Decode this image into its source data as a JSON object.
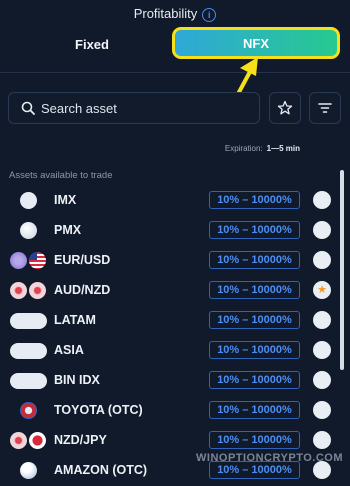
{
  "header": {
    "title": "Profitability",
    "info_icon": "info-icon",
    "tabs": [
      {
        "label": "Fixed",
        "selected": false
      },
      {
        "label": "NFX",
        "selected": true
      }
    ],
    "highlight_color": "#f7e019",
    "nfx_gradient": [
      "#2fa8d9",
      "#27c98f"
    ]
  },
  "search": {
    "placeholder": "Search asset",
    "icon": "search-icon"
  },
  "toolbar": {
    "favorites_icon": "star-icon",
    "filter_icon": "filter-icon"
  },
  "expiration": {
    "label": "Expiration:",
    "value": "1—5 min"
  },
  "section_label": "Assets available to trade",
  "assets": [
    {
      "name": "IMX",
      "payout": "10% – 10000%",
      "favorite": false
    },
    {
      "name": "PMX",
      "payout": "10% – 10000%",
      "favorite": false
    },
    {
      "name": "EUR/USD",
      "payout": "10% – 10000%",
      "favorite": false
    },
    {
      "name": "AUD/NZD",
      "payout": "10% – 10000%",
      "favorite": true
    },
    {
      "name": "LATAM",
      "payout": "10% – 10000%",
      "favorite": false
    },
    {
      "name": "ASIA",
      "payout": "10% – 10000%",
      "favorite": false
    },
    {
      "name": "BIN IDX",
      "payout": "10% – 10000%",
      "favorite": false
    },
    {
      "name": "TOYOTA (OTC)",
      "payout": "10% – 10000%",
      "favorite": false
    },
    {
      "name": "NZD/JPY",
      "payout": "10% – 10000%",
      "favorite": false
    },
    {
      "name": "AMAZON (OTC)",
      "payout": "10% – 10000%",
      "favorite": false
    }
  ],
  "colors": {
    "background": "#101a2b",
    "payout_text": "#4b8ef5",
    "payout_border": "#2d63b8",
    "favorite_star": "#f39a1b"
  },
  "watermark": "WINOPTIONCRYPTO.COM"
}
